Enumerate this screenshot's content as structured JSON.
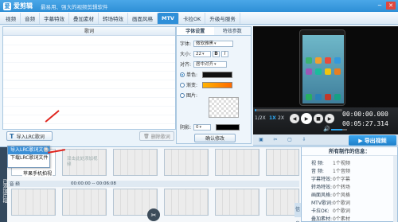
{
  "window": {
    "logo": "爱",
    "app_name": "爱剪辑",
    "tagline": "最易用、强大的视频剪辑软件",
    "minimize": "─",
    "close": "✕"
  },
  "menu": {
    "tabs": [
      "视频",
      "音频",
      "字幕特效",
      "叠加素材",
      "转场特效",
      "画面风格",
      "MTV",
      "卡拉OK",
      "升级与服务"
    ],
    "active": "MTV"
  },
  "lyrics": {
    "header": "歌词"
  },
  "settings": {
    "tabs": [
      "字体设置",
      "特效参数"
    ],
    "font_label": "字体:",
    "font_value": "微软雅黑",
    "size_label": "大小:",
    "size_value": "22",
    "bold_label": "B",
    "italic_label": "I",
    "align_label": "对齐:",
    "align_value": "居中对齐",
    "single_color_label": "单色:",
    "gradient_label": "渐变:",
    "image_label": "图片:",
    "shadow_label": "阴影:",
    "shadow_value": "0",
    "confirm_label": "确认修改",
    "colors": {
      "single": "#111111",
      "gradient_start": "#ffb300",
      "gradient_end": "#ff6a00"
    }
  },
  "player": {
    "progress_fraction": 0.02,
    "speeds": [
      "1/2X",
      "1X",
      "2X"
    ],
    "active_speed": "1X",
    "current_time": "00:00:00.000",
    "total_time": "00:05:27.314",
    "volume_icon": "🔊"
  },
  "export": {
    "label": "导出视频",
    "icon": "▶",
    "tool_icons": [
      "▣",
      "✂",
      "▢",
      "⇩"
    ]
  },
  "toolbar": {
    "import_icon": "T",
    "import_label": "导入LRC歌词",
    "delete_label": "删除歌词",
    "delete_icon": "🗑"
  },
  "popup": {
    "items": [
      "导入LRC歌词文件",
      "下载LRC歌词文件"
    ],
    "highlighted": 0,
    "close": "✕"
  },
  "timeline": {
    "side_label": "已添加片段",
    "clip_caption": "苹果手机拍视",
    "empty_text": "双击此处添加视频",
    "audio_label": "音  频",
    "audio_time": "00:00:00 -- 00:06:08",
    "cut_icon": "✂"
  },
  "info": {
    "title": "所有制作的信息：",
    "rows": [
      {
        "k": "视  频:",
        "v": "1个视频"
      },
      {
        "k": "音  频:",
        "v": "1个音频"
      },
      {
        "k": "字幕特效:",
        "v": "0个字幕"
      },
      {
        "k": "转场特效:",
        "v": "0个转场"
      },
      {
        "k": "画面风格:",
        "v": "0个风格"
      },
      {
        "k": "MTV歌词:",
        "v": "0个歌词"
      },
      {
        "k": "卡拉OK:",
        "v": "0个歌词"
      },
      {
        "k": "叠加素材:",
        "v": "0个素材"
      }
    ],
    "side_button": "信息"
  }
}
